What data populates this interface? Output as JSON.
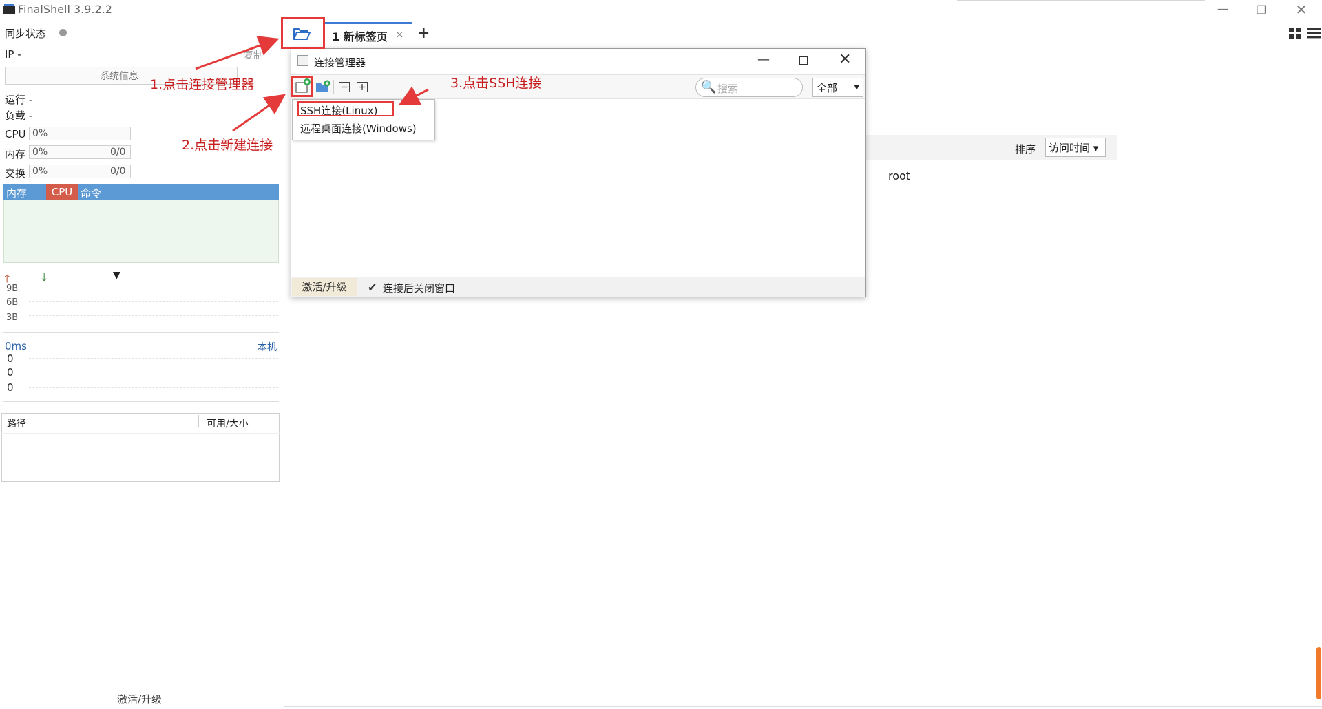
{
  "window": {
    "title": "FinalShell 3.9.2.2",
    "minimize": "—",
    "maximize": "❐",
    "close": "✕"
  },
  "left": {
    "sync_status": "同步状态",
    "ip": "IP  -",
    "copy": "复制",
    "system_info": "系统信息",
    "running": "运行 -",
    "load": "负载 -",
    "cpu_label": "CPU",
    "cpu_value": "0%",
    "mem_label": "内存",
    "mem_value": "0%",
    "mem_ratio": "0/0",
    "swap_label": "交换",
    "swap_value": "0%",
    "swap_ratio": "0/0",
    "tab_mem": "内存",
    "tab_cpu": "CPU",
    "tab_cmd": "命令",
    "net_up": "🡑",
    "net_down": "🡓",
    "net_dropdown": "▼",
    "net_ticks": [
      "9B",
      "6B",
      "3B"
    ],
    "ping": "0ms",
    "ping_target": "本机",
    "ping_values": [
      "0",
      "0",
      "0"
    ],
    "fs_path": "路径",
    "fs_size": "可用/大小",
    "upgrade": "激活/升级"
  },
  "tabs": {
    "new_tab": "1 新标签页",
    "close": "×",
    "add": "+"
  },
  "main": {
    "sort_label": "排序",
    "sort_value": "访问时间 ▾",
    "user": "root"
  },
  "dialog": {
    "title": "连接管理器",
    "minimize": "—",
    "close": "✕",
    "search_placeholder": "搜索",
    "search_icon": "🔍",
    "filter": "全部",
    "filter_arrow": "▾",
    "upgrade": "激活/升级",
    "checkbox_mark": "✔",
    "close_after_connect": "连接后关闭窗口",
    "menu": {
      "ssh": "SSH连接(Linux)",
      "rdp": "远程桌面连接(Windows)"
    }
  },
  "annotations": {
    "step1": "1.点击连接管理器",
    "step2": "2.点击新建连接",
    "step3": "3.点击SSH连接"
  },
  "colors": {
    "accent": "#3c7ad6",
    "annotation": "#e53a3a",
    "cpu_tab": "#d45c4a",
    "mem_tab": "#5c9ad6"
  }
}
